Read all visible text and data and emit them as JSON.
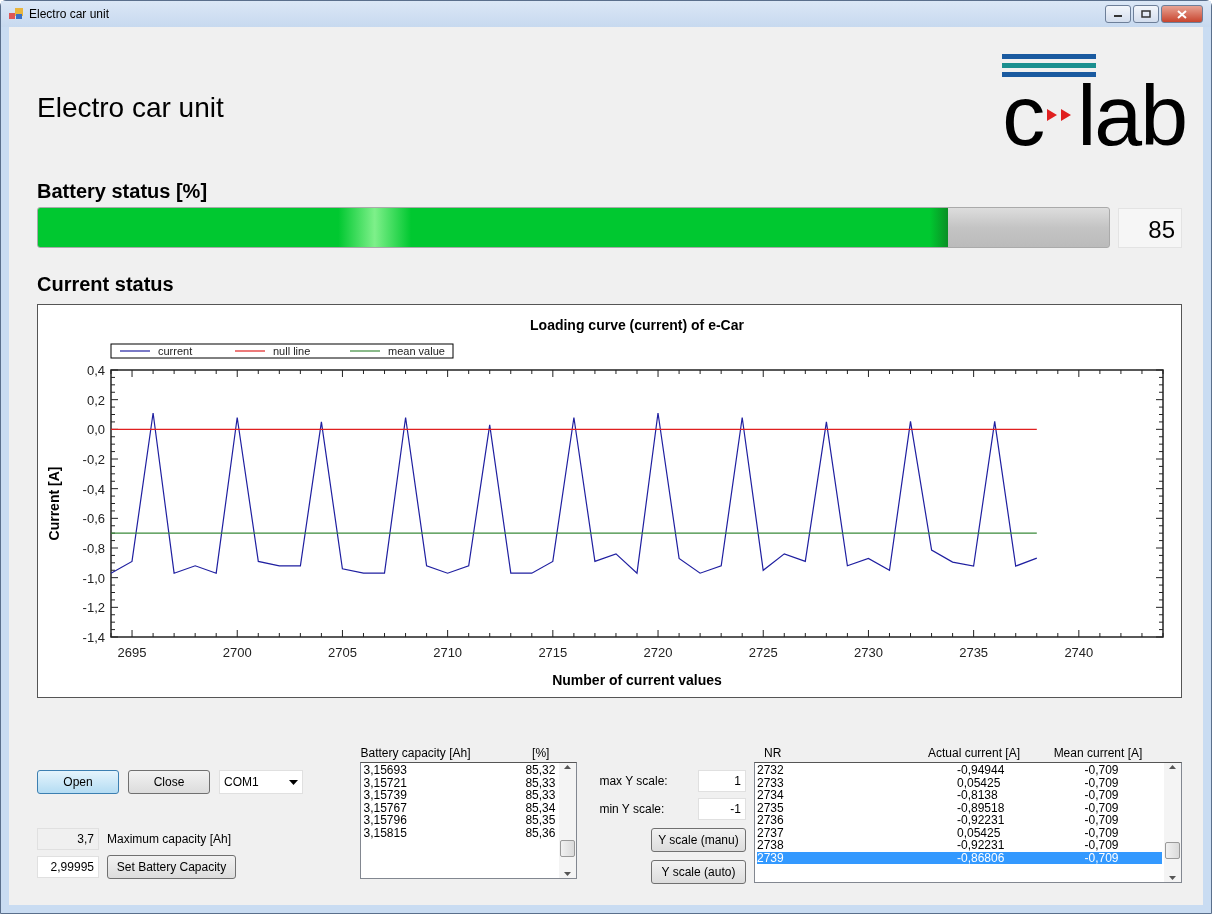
{
  "window": {
    "title": "Electro car unit"
  },
  "header": {
    "title": "Electro car unit",
    "logo": {
      "left": "c",
      "right": "lab"
    }
  },
  "battery": {
    "label": "Battery status [%]",
    "level": 0.85,
    "reading": "85"
  },
  "current": {
    "label": "Current status",
    "chart_data": {
      "type": "line",
      "title": "Loading curve (current) of e-Car",
      "xlabel": "Number of current values",
      "ylabel": "Current [A]",
      "x": [
        2694,
        2695,
        2696,
        2697,
        2698,
        2699,
        2700,
        2701,
        2702,
        2703,
        2704,
        2705,
        2706,
        2707,
        2708,
        2709,
        2710,
        2711,
        2712,
        2713,
        2714,
        2715,
        2716,
        2717,
        2718,
        2719,
        2720,
        2721,
        2722,
        2723,
        2724,
        2725,
        2726,
        2727,
        2728,
        2729,
        2730,
        2731,
        2732,
        2733,
        2734,
        2735,
        2736,
        2737,
        2738
      ],
      "series": [
        {
          "name": "current",
          "color": "#1f1fa0",
          "values": [
            -0.97,
            -0.89,
            0.11,
            -0.97,
            -0.92,
            -0.97,
            0.08,
            -0.89,
            -0.92,
            -0.92,
            0.05,
            -0.94,
            -0.97,
            -0.97,
            0.08,
            -0.92,
            -0.97,
            -0.92,
            0.03,
            -0.97,
            -0.97,
            -0.89,
            0.08,
            -0.89,
            -0.84,
            -0.97,
            0.11,
            -0.87,
            -0.97,
            -0.92,
            0.08,
            -0.95,
            -0.84,
            -0.89,
            0.05,
            -0.92,
            -0.87,
            -0.95,
            0.054,
            -0.814,
            -0.895,
            -0.922,
            0.054,
            -0.922,
            -0.868
          ]
        },
        {
          "name": "null line",
          "color": "#e02020",
          "values": [
            0,
            0,
            0,
            0,
            0,
            0,
            0,
            0,
            0,
            0,
            0,
            0,
            0,
            0,
            0,
            0,
            0,
            0,
            0,
            0,
            0,
            0,
            0,
            0,
            0,
            0,
            0,
            0,
            0,
            0,
            0,
            0,
            0,
            0,
            0,
            0,
            0,
            0,
            0,
            0,
            0,
            0,
            0,
            0,
            0
          ]
        },
        {
          "name": "mean value",
          "color": "#3a8a3a",
          "values": [
            -0.7,
            -0.7,
            -0.7,
            -0.7,
            -0.7,
            -0.7,
            -0.7,
            -0.7,
            -0.7,
            -0.7,
            -0.7,
            -0.7,
            -0.7,
            -0.7,
            -0.7,
            -0.7,
            -0.7,
            -0.7,
            -0.7,
            -0.7,
            -0.7,
            -0.7,
            -0.7,
            -0.7,
            -0.7,
            -0.7,
            -0.7,
            -0.7,
            -0.7,
            -0.7,
            -0.7,
            -0.7,
            -0.7,
            -0.7,
            -0.7,
            -0.7,
            -0.7,
            -0.7,
            -0.7,
            -0.7,
            -0.7,
            -0.7,
            -0.7,
            -0.7,
            -0.7
          ]
        }
      ],
      "legend": true,
      "xlim": [
        2694,
        2744
      ],
      "ylim": [
        -1.4,
        0.4
      ],
      "xticks": [
        2695,
        2700,
        2705,
        2710,
        2715,
        2720,
        2725,
        2730,
        2735,
        2740
      ],
      "yticks": [
        {
          "value": 0.4,
          "label": "0,4"
        },
        {
          "value": 0.2,
          "label": "0,2"
        },
        {
          "value": 0,
          "label": "0,0"
        },
        {
          "value": -0.2,
          "label": "-0,2"
        },
        {
          "value": -0.4,
          "label": "-0,4"
        },
        {
          "value": -0.6,
          "label": "-0,6"
        },
        {
          "value": -0.8,
          "label": "-0,8"
        },
        {
          "value": -1.0,
          "label": "-1,0"
        },
        {
          "value": -1.2,
          "label": "-1,2"
        },
        {
          "value": -1.4,
          "label": "-1,4"
        }
      ]
    }
  },
  "connection": {
    "buttons": [
      {
        "label": "Open",
        "highlighted": true
      },
      {
        "label": "Close",
        "highlighted": false
      }
    ],
    "port": "COM1"
  },
  "capacity": {
    "max_value": "3,7",
    "max_label": "Maximum capacity [Ah]",
    "value": "2,99995",
    "button": "Set Battery Capacity"
  },
  "capacity_list": {
    "columns": [
      "Battery capacity [Ah]",
      "[%]"
    ],
    "rows": [
      [
        "3,15693",
        "85,32"
      ],
      [
        "3,15721",
        "85,33"
      ],
      [
        "3,15739",
        "85,33"
      ],
      [
        "3,15767",
        "85,34"
      ],
      [
        "3,15796",
        "85,35"
      ],
      [
        "3,15815",
        "85,36"
      ]
    ]
  },
  "scale": {
    "max_label": "max Y scale:",
    "max_value": "1",
    "min_label": "min Y scale:",
    "min_value": "-1",
    "buttons": [
      "Y scale (manu)",
      "Y scale (auto)"
    ]
  },
  "data_table": {
    "columns": [
      "NR",
      "Actual current [A]",
      "Mean current [A]"
    ],
    "rows": [
      {
        "cells": [
          "2732",
          "-0,94944",
          "-0,709"
        ],
        "selected": false
      },
      {
        "cells": [
          "2733",
          "0,05425",
          "-0,709"
        ],
        "selected": false
      },
      {
        "cells": [
          "2734",
          "-0,8138",
          "-0,709"
        ],
        "selected": false
      },
      {
        "cells": [
          "2735",
          "-0,89518",
          "-0,709"
        ],
        "selected": false
      },
      {
        "cells": [
          "2736",
          "-0,92231",
          "-0,709"
        ],
        "selected": false
      },
      {
        "cells": [
          "2737",
          "0,05425",
          "-0,709"
        ],
        "selected": false
      },
      {
        "cells": [
          "2738",
          "-0,92231",
          "-0,709"
        ],
        "selected": false
      },
      {
        "cells": [
          "2739",
          "-0,86806",
          "-0,709"
        ],
        "selected": true
      }
    ]
  }
}
